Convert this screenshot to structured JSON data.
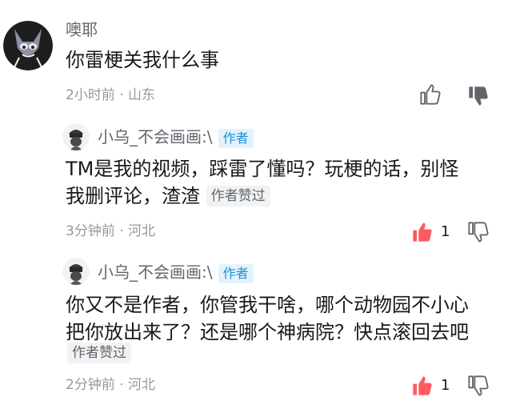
{
  "comments": [
    {
      "user": "噢耶",
      "text": "你雷梗关我什么事",
      "time": "2小时前",
      "location": "山东"
    },
    {
      "user": "小乌_不会画画:\\",
      "badge": "作者",
      "text_line1": "TM是我的视频，踩雷了懂吗？玩梗的话，别怪",
      "text_line2": "我删评论，渣渣",
      "author_liked": "作者赞过",
      "time": "3分钟前",
      "location": "河北",
      "likes": "1"
    },
    {
      "user": "小乌_不会画画:\\",
      "badge": "作者",
      "text_line1": "你又不是作者，你管我干啥，哪个动物园不小心",
      "text_line2": "把你放出来了？还是哪个神病院？快点滚回去吧",
      "author_liked": "作者赞过",
      "time": "2分钟前",
      "location": "河北",
      "likes": "1"
    }
  ],
  "separator": " · ",
  "colors": {
    "like_active": "#ff5a5f",
    "badge_bg": "#e3f2fd",
    "badge_text": "#1a90d8"
  }
}
